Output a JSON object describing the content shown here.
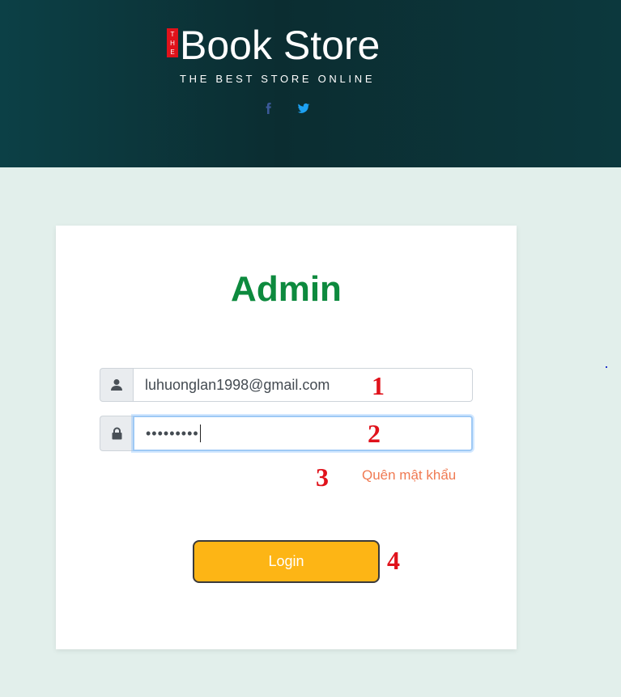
{
  "header": {
    "logo_badge": [
      "T",
      "H",
      "E"
    ],
    "logo_title": "Book Store",
    "tagline": "THE BEST STORE ONLINE",
    "social_icons": [
      "facebook-icon",
      "twitter-icon"
    ]
  },
  "login_card": {
    "title": "Admin",
    "email": {
      "icon": "user-icon",
      "value": "luhuonglan1998@gmail.com"
    },
    "password": {
      "icon": "lock-icon",
      "value": "•••••••••"
    },
    "forgot_link": "Quên mật khẩu",
    "login_button": "Login"
  },
  "annotations": [
    "1",
    "2",
    "3",
    "4"
  ],
  "colors": {
    "header_bg": "#0b2d31",
    "page_bg": "#e2efeb",
    "title_green": "#0d8a3e",
    "forgot_orange": "#f07a52",
    "button_yellow": "#fdb515",
    "annotation_red": "#e0121b",
    "facebook_blue": "#3b5998",
    "twitter_blue": "#1da1f2"
  }
}
